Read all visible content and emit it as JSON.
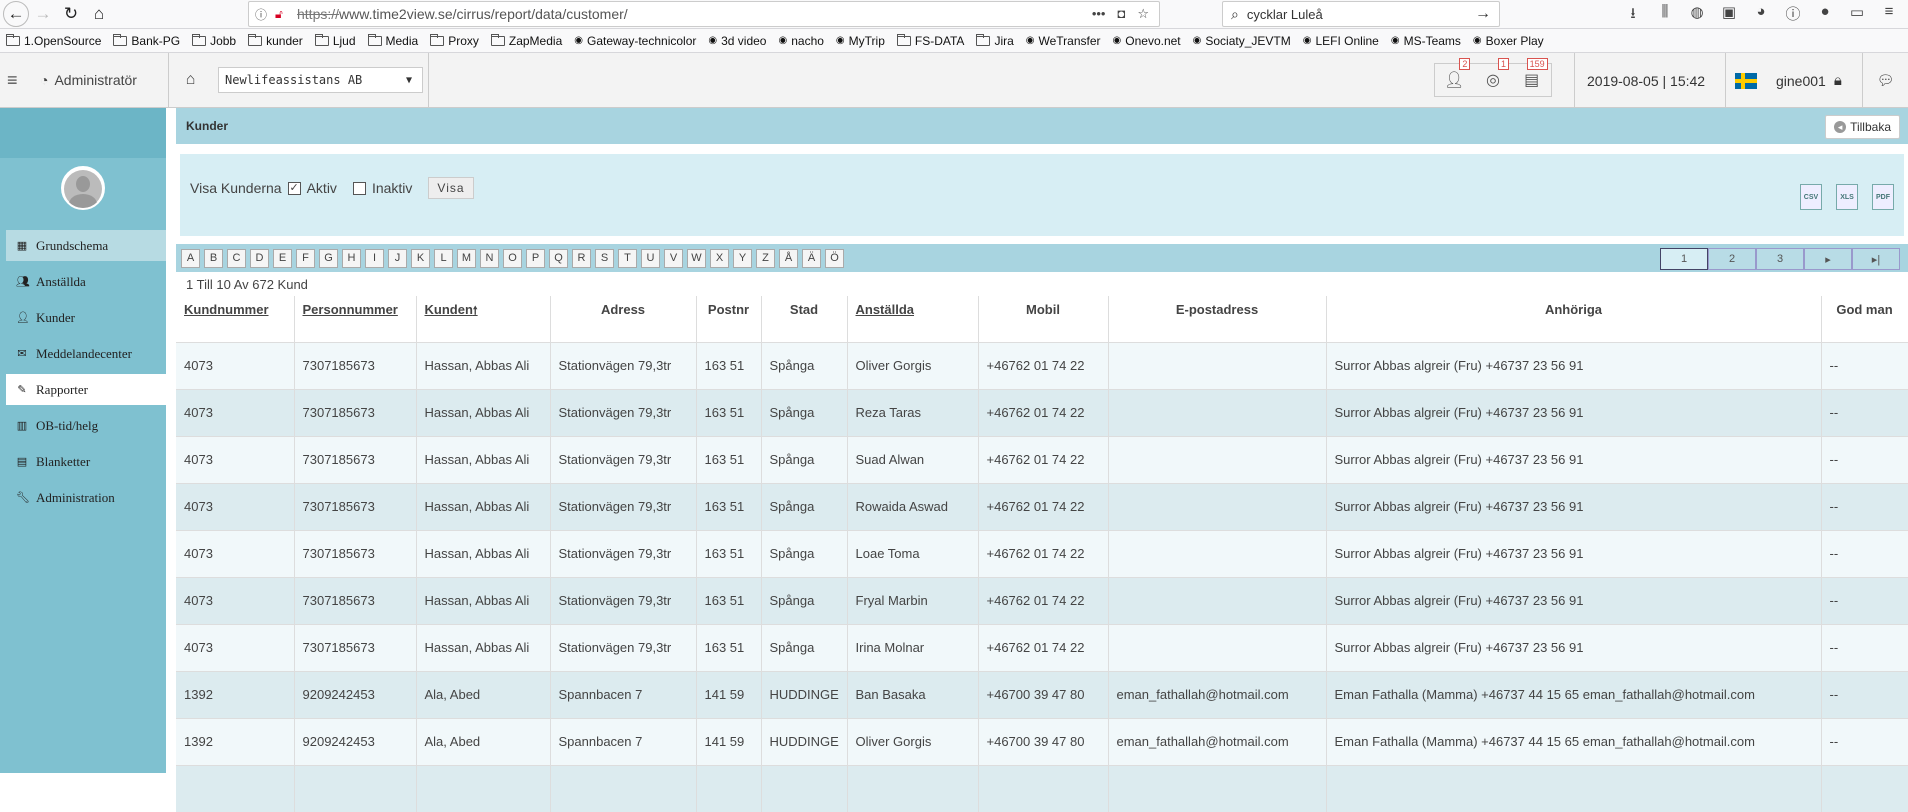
{
  "browser": {
    "url_scheme": "https://",
    "url_rest": "www.time2view.se/cirrus/report/data/customer/",
    "search_text": "cycklar Luleå",
    "bookmarks": [
      "1.OpenSource",
      "Bank-PG",
      "Jobb",
      "kunder",
      "Ljud",
      "Media",
      "Proxy",
      "ZapMedia",
      "Gateway-technicolor",
      "3d video",
      "nacho",
      "MyTrip",
      "FS-DATA",
      "Jira",
      "WeTransfer",
      "Onevo.net",
      "Sociaty_JEVTM",
      "LEFI Online",
      "MS-Teams",
      "Boxer Play"
    ],
    "bookmark_icons": [
      "folder",
      "folder",
      "folder",
      "folder",
      "folder",
      "folder",
      "folder",
      "folder",
      "globe-icon",
      "rss-icon",
      "mail-icon",
      "mytrip-icon",
      "folder",
      "folder",
      "wetransfer-icon",
      "onevo-icon",
      "rss-icon",
      "rss-icon",
      "teams-icon",
      "boxer-icon"
    ]
  },
  "header": {
    "role": "Administratör",
    "company": "Newlifeassistans AB",
    "badges": {
      "users": "2",
      "support": "1",
      "messages": "159"
    },
    "datetime": "2019-08-05 | 15:42",
    "username": "gine001"
  },
  "sidebar": {
    "items": [
      {
        "label": "Grundschema",
        "icon": "calendar-icon"
      },
      {
        "label": "Anställda",
        "icon": "users-icon"
      },
      {
        "label": "Kunder",
        "icon": "user-icon"
      },
      {
        "label": "Meddelandecenter",
        "icon": "envelope-icon"
      },
      {
        "label": "Rapporter",
        "icon": "pencil-icon"
      },
      {
        "label": "OB-tid/helg",
        "icon": "chart-icon"
      },
      {
        "label": "Blanketter",
        "icon": "file-icon"
      },
      {
        "label": "Administration",
        "icon": "wrench-icon"
      }
    ]
  },
  "page": {
    "title": "Kunder",
    "back_label": "Tillbaka",
    "filter_label": "Visa Kunderna",
    "active_label": "Aktiv",
    "inactive_label": "Inaktiv",
    "show_button": "Visa",
    "export": [
      "CSV",
      "XLS",
      "PDF"
    ],
    "letters": [
      "A",
      "B",
      "C",
      "D",
      "E",
      "F",
      "G",
      "H",
      "I",
      "J",
      "K",
      "L",
      "M",
      "N",
      "O",
      "P",
      "Q",
      "R",
      "S",
      "T",
      "U",
      "V",
      "W",
      "X",
      "Y",
      "Z",
      "Å",
      "Ä",
      "Ö"
    ],
    "pages": [
      "1",
      "2",
      "3",
      "▸",
      "▸|"
    ],
    "summary": "1 Till 10 Av 672 Kund"
  },
  "table": {
    "columns": [
      "Kundnummer",
      "Personnummer",
      "Kunden",
      "Adress",
      "Postnr",
      "Stad",
      "Anställda",
      "Mobil",
      "E-postadress",
      "Anhöriga",
      "God man"
    ],
    "sort_indicator": "🠕",
    "rows": [
      [
        "4073",
        "7307185673",
        "Hassan, Abbas Ali",
        "Stationvägen 79,3tr",
        "163 51",
        "Spånga",
        "Oliver Gorgis",
        "+46762 01 74 22",
        "",
        "Surror Abbas algreir (Fru) +46737 23 56 91",
        "--"
      ],
      [
        "4073",
        "7307185673",
        "Hassan, Abbas Ali",
        "Stationvägen 79,3tr",
        "163 51",
        "Spånga",
        "Reza Taras",
        "+46762 01 74 22",
        "",
        "Surror Abbas algreir (Fru) +46737 23 56 91",
        "--"
      ],
      [
        "4073",
        "7307185673",
        "Hassan, Abbas Ali",
        "Stationvägen 79,3tr",
        "163 51",
        "Spånga",
        "Suad Alwan",
        "+46762 01 74 22",
        "",
        "Surror Abbas algreir (Fru) +46737 23 56 91",
        "--"
      ],
      [
        "4073",
        "7307185673",
        "Hassan, Abbas Ali",
        "Stationvägen 79,3tr",
        "163 51",
        "Spånga",
        "Rowaida Aswad",
        "+46762 01 74 22",
        "",
        "Surror Abbas algreir (Fru) +46737 23 56 91",
        "--"
      ],
      [
        "4073",
        "7307185673",
        "Hassan, Abbas Ali",
        "Stationvägen 79,3tr",
        "163 51",
        "Spånga",
        "Loae Toma",
        "+46762 01 74 22",
        "",
        "Surror Abbas algreir (Fru) +46737 23 56 91",
        "--"
      ],
      [
        "4073",
        "7307185673",
        "Hassan, Abbas Ali",
        "Stationvägen 79,3tr",
        "163 51",
        "Spånga",
        "Fryal Marbin",
        "+46762 01 74 22",
        "",
        "Surror Abbas algreir (Fru) +46737 23 56 91",
        "--"
      ],
      [
        "4073",
        "7307185673",
        "Hassan, Abbas Ali",
        "Stationvägen 79,3tr",
        "163 51",
        "Spånga",
        "Irina Molnar",
        "+46762 01 74 22",
        "",
        "Surror Abbas algreir (Fru) +46737 23 56 91",
        "--"
      ],
      [
        "1392",
        "9209242453",
        "Ala, Abed",
        "Spannbacen 7",
        "141 59",
        "HUDDINGE",
        "Ban Basaka",
        "+46700 39 47 80",
        "eman_fathallah@hotmail.com",
        "Eman Fathalla (Mamma) +46737 44 15 65 eman_fathallah@hotmail.com",
        "--"
      ],
      [
        "1392",
        "9209242453",
        "Ala, Abed",
        "Spannbacen 7",
        "141 59",
        "HUDDINGE",
        "Oliver Gorgis",
        "+46700 39 47 80",
        "eman_fathallah@hotmail.com",
        "Eman Fathalla (Mamma) +46737 44 15 65 eman_fathallah@hotmail.com",
        "--"
      ],
      [
        "",
        "",
        "",
        "",
        "",
        "",
        "",
        "",
        "",
        "",
        ""
      ]
    ]
  }
}
